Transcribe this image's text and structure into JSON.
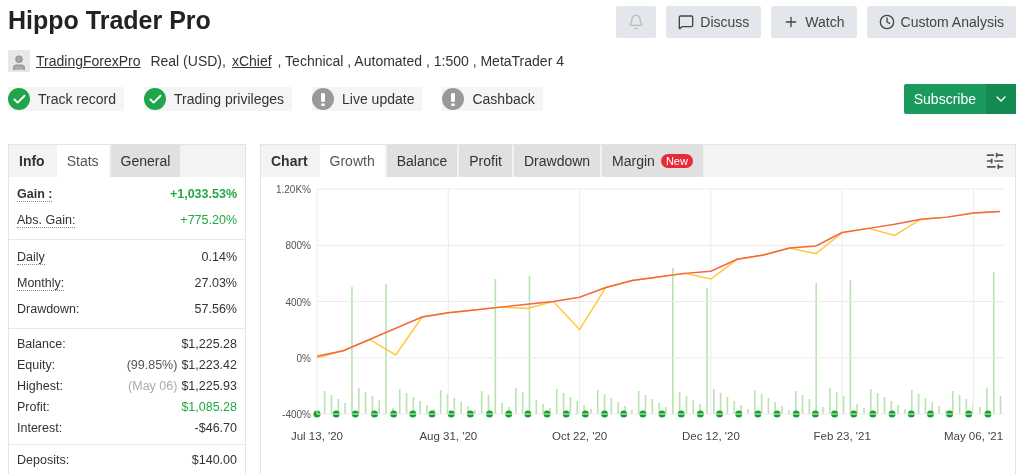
{
  "title": "Hippo Trader Pro",
  "header_buttons": [
    {
      "kind": "bell"
    },
    {
      "kind": "chat",
      "label": "Discuss"
    },
    {
      "kind": "plus",
      "label": "Watch"
    },
    {
      "kind": "clock",
      "label": "Custom Analysis"
    }
  ],
  "owner": {
    "name": "TradingForexPro",
    "before_link": "Real (USD),",
    "link": "xChief",
    "after_link": ", Technical , Automated , 1:500 , MetaTrader 4"
  },
  "badges": [
    {
      "label": "Track record",
      "verified": true
    },
    {
      "label": "Trading privileges",
      "verified": true
    },
    {
      "label": "Live update",
      "verified": false
    },
    {
      "label": "Cashback",
      "verified": false
    }
  ],
  "subscribe": {
    "label": "Subscribe"
  },
  "stats_tabs": [
    {
      "label": "Info",
      "kind": "title"
    },
    {
      "label": "Stats",
      "selected": true,
      "kind": "tab"
    },
    {
      "label": "General",
      "selected": false,
      "kind": "tab"
    }
  ],
  "stats_groups": [
    [
      {
        "label": "Gain :",
        "value": "+1,033.53%",
        "underline": true,
        "bold": true,
        "positive": true
      },
      {
        "label": "Abs. Gain:",
        "value": "+775.20%",
        "underline": true,
        "bold": false,
        "positive": true
      }
    ],
    [
      {
        "label": "Daily",
        "value": "0.14%",
        "underline": true,
        "bold": false,
        "positive": false
      },
      {
        "label": "Monthly:",
        "value": "27.03%",
        "underline": true,
        "bold": false,
        "positive": false
      },
      {
        "label": "Drawdown:",
        "value": "57.56%",
        "underline": false,
        "bold": false,
        "positive": false
      }
    ],
    [
      {
        "label": "Balance:",
        "value": "$1,225.28",
        "underline": false,
        "bold": false,
        "positive": false
      },
      {
        "label": "Equity:",
        "note": "(99.85%)",
        "value": "$1,223.42",
        "underline": false,
        "bold": false,
        "positive": false,
        "note_muted": false
      },
      {
        "label": "Highest:",
        "note": "(May 06)",
        "value": "$1,225.93",
        "underline": false,
        "bold": false,
        "positive": false,
        "note_muted": true
      },
      {
        "label": "Profit:",
        "value": "$1,085.28",
        "underline": false,
        "bold": false,
        "positive": true
      },
      {
        "label": "Interest:",
        "value": "-$46.70",
        "underline": false,
        "bold": false,
        "positive": false
      }
    ],
    [
      {
        "label": "Deposits:",
        "value": "$140.00",
        "underline": false,
        "bold": false,
        "positive": false
      }
    ]
  ],
  "chart_tabs": [
    {
      "label": "Chart",
      "kind": "title"
    },
    {
      "label": "Growth",
      "selected": true,
      "kind": "tab"
    },
    {
      "label": "Balance",
      "selected": false,
      "kind": "tab"
    },
    {
      "label": "Profit",
      "selected": false,
      "kind": "tab"
    },
    {
      "label": "Drawdown",
      "selected": false,
      "kind": "tab"
    },
    {
      "label": "Margin",
      "selected": false,
      "kind": "tab",
      "badge": "New"
    }
  ],
  "chart_data": {
    "type": "line",
    "categories": [
      "Jul 13, '20",
      null,
      null,
      null,
      null,
      "Aug 31, '20",
      null,
      null,
      null,
      null,
      "Oct 22, '20",
      null,
      null,
      null,
      null,
      "Dec 12, '20",
      null,
      null,
      null,
      null,
      "Feb 23, '21",
      null,
      null,
      null,
      null,
      "May 06, '21",
      null
    ],
    "ylim": [
      -400,
      1200
    ],
    "grid": true,
    "yticks": [
      {
        "value": -400,
        "label": "-400%"
      },
      {
        "value": 0,
        "label": "0%"
      },
      {
        "value": 400,
        "label": "400%"
      },
      {
        "value": 800,
        "label": "800%"
      },
      {
        "value": 1200,
        "label": "1.20K%"
      }
    ],
    "series": [
      {
        "color": "#ffc93c",
        "values": [
          0,
          50,
          130,
          20,
          290,
          320,
          340,
          360,
          350,
          400,
          200,
          500,
          550,
          575,
          600,
          560,
          700,
          730,
          780,
          740,
          890,
          920,
          870,
          985,
          1000,
          1030,
          1040
        ]
      },
      {
        "color": "#f4673f",
        "values": [
          10,
          50,
          130,
          210,
          290,
          320,
          340,
          360,
          380,
          400,
          430,
          500,
          550,
          575,
          600,
          615,
          700,
          730,
          780,
          795,
          890,
          920,
          950,
          985,
          1000,
          1030,
          1040
        ]
      }
    ]
  }
}
